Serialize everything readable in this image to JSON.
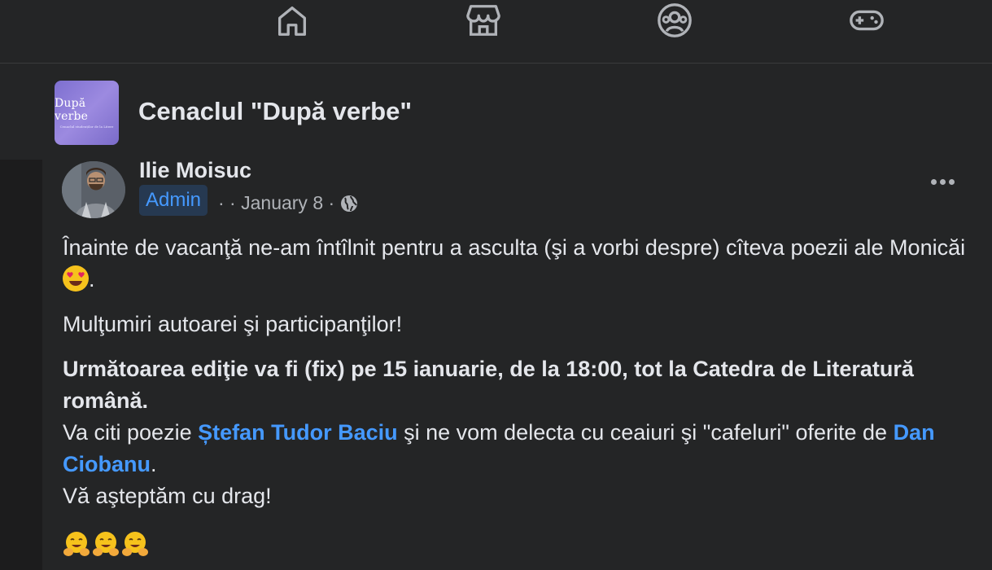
{
  "nav": {
    "items": [
      {
        "name": "home-icon"
      },
      {
        "name": "marketplace-icon"
      },
      {
        "name": "groups-icon"
      },
      {
        "name": "gaming-icon"
      }
    ]
  },
  "group": {
    "logo_text": "După verbe",
    "logo_subtext": "Cenaclul studenților de la Litere",
    "name": "Cenaclul \"După verbe\""
  },
  "post": {
    "author": "Ilie Moisuc",
    "badge": "Admin",
    "meta_dots": "· ·",
    "date": "January 8",
    "separator": "·",
    "privacy_icon": "globe-icon",
    "p1_text": "Înainte de vacanţă ne-am întîlnit pentru a asculta (şi a vorbi despre) cîteva poezii ale Monicăi",
    "p1_end": ".",
    "p2": "Mulţumiri autoarei şi participanţilor!",
    "p3_bold": "Următoarea ediţie va fi (fix) pe 15 ianuarie, de la 18:00, tot la Catedra de Literatură română.",
    "p3_line2_start": "Va citi poezie ",
    "mention1": "Ștefan Tudor Baciu",
    "p3_line2_mid": " şi ne vom delecta cu ceaiuri şi \"cafeluri\" oferite de ",
    "mention2": "Dan Ciobanu",
    "p3_line2_end": ".",
    "p3_line3": "Vă aşteptăm cu drag!"
  },
  "colors": {
    "background": "#1c1c1d",
    "surface": "#242526",
    "text_primary": "#e4e6eb",
    "text_secondary": "#b0b3b8",
    "link": "#4599ff",
    "badge_bg": "#263951"
  }
}
